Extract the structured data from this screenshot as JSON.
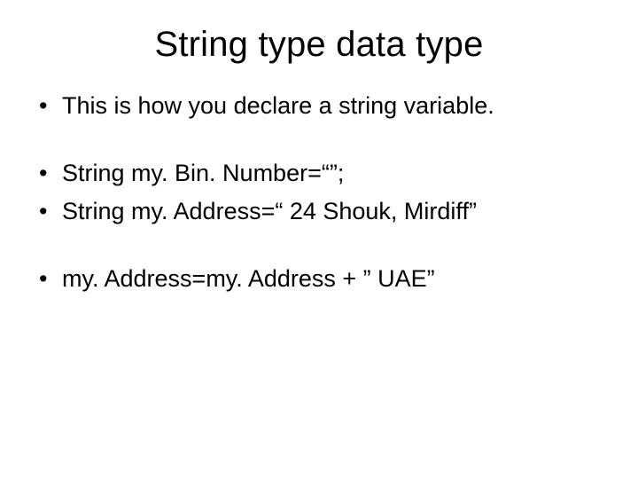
{
  "title": "String type data type",
  "bullets": {
    "b1": "This is how you declare a string variable.",
    "b2": "String my. Bin. Number=“”;",
    "b3": "String my. Address=“ 24 Shouk, Mirdiff”",
    "b4": "my. Address=my. Address + ” UAE”"
  }
}
